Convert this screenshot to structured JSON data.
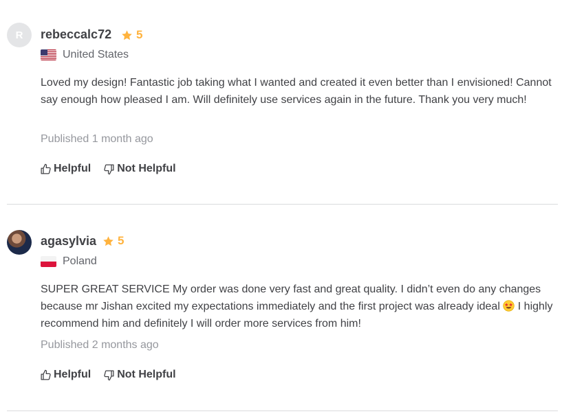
{
  "reviews": [
    {
      "avatar_letter": "R",
      "username": "rebeccalc72",
      "rating": "5",
      "country": "United States",
      "text": "Loved my design! Fantastic job taking what I wanted and created it even better than I envisioned! Cannot say enough how pleased I am. Will definitely use services again in the future. Thank you very much!",
      "published": "Published 1 month ago",
      "helpful_label": "Helpful",
      "not_helpful_label": "Not Helpful"
    },
    {
      "username": "agasylvia",
      "rating": "5",
      "country": "Poland",
      "text_part1": "SUPER GREAT SERVICE My order was done very fast and great quality. I didn’t even do any changes because mr Jishan excited my expectations immediately and the first project was already ideal",
      "text_part2": " I highly recommend him and definitely I will order more services from him!",
      "emoji": "star-struck-emoji",
      "published": "Published 2 months ago",
      "helpful_label": "Helpful",
      "not_helpful_label": "Not Helpful"
    }
  ],
  "colors": {
    "star": "#ffb33e",
    "text": "#404145",
    "muted": "#95979d",
    "divider": "#dadbdd"
  }
}
